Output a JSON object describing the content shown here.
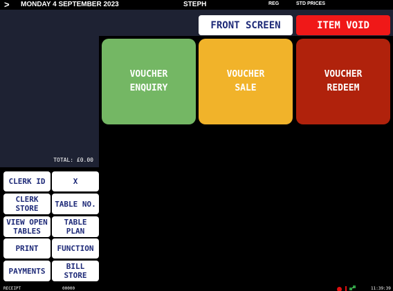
{
  "header": {
    "chevron": ">",
    "date": "MONDAY 4 SEPTEMBER 2023",
    "user": "STEPH",
    "reg": "REG",
    "prices": "STD PRICES"
  },
  "top_buttons": {
    "front_screen": "FRONT SCREEN",
    "item_void": "ITEM VOID"
  },
  "receipt_panel": {
    "total": "TOTAL: £0.00"
  },
  "left_buttons": [
    "CLERK ID",
    "X",
    "CLERK\nSTORE",
    "TABLE NO.",
    "VIEW OPEN\nTABLES",
    "TABLE\nPLAN",
    "PRINT",
    "FUNCTION",
    "PAYMENTS",
    "BILL\nSTORE"
  ],
  "tiles": [
    {
      "label": "VOUCHER\nENQUIRY",
      "color": "#74b764"
    },
    {
      "label": "VOUCHER\nSALE",
      "color": "#f1b32a"
    },
    {
      "label": "VOUCHER\nREDEEM",
      "color": "#b0220c"
    }
  ],
  "colors": {
    "panel": "#1e2233",
    "button_text": "#1e2a78",
    "void": "#f01818"
  },
  "status_bar": {
    "receipt": "RECEIPT",
    "receipt_number": "00000",
    "time": "11:39:39"
  }
}
